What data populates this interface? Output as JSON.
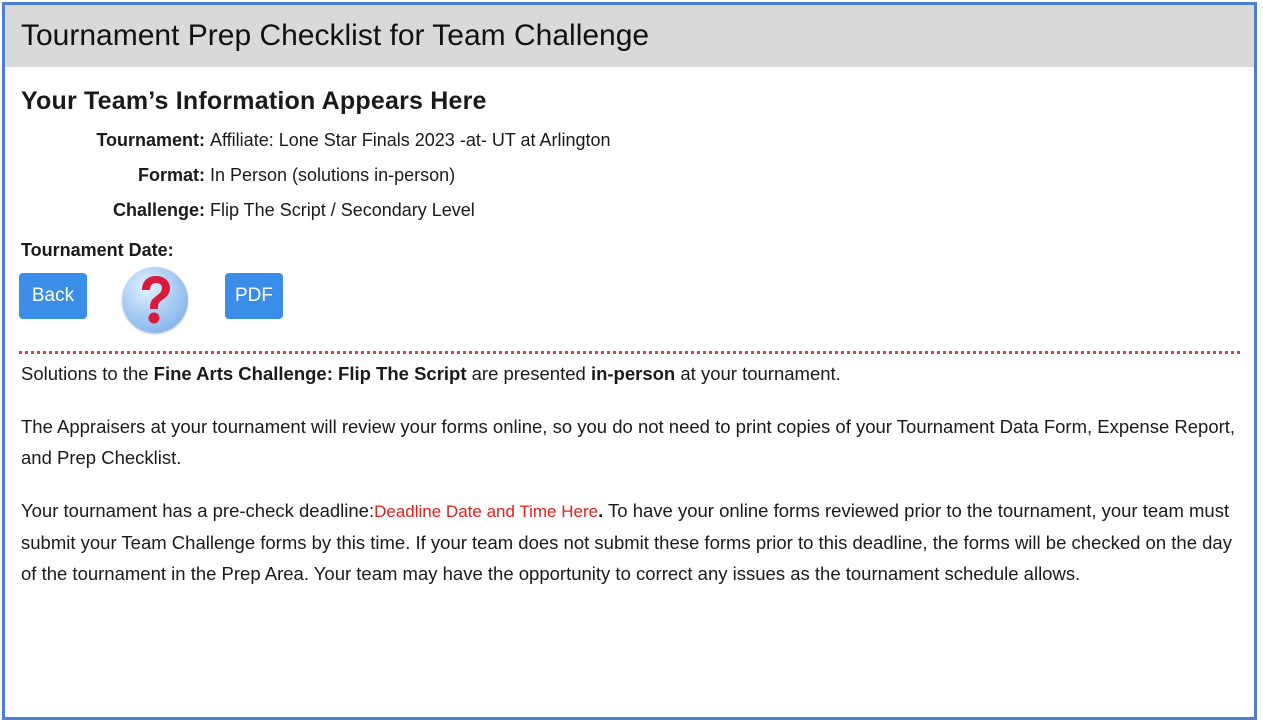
{
  "page_title": "Tournament Prep Checklist for Team Challenge",
  "section_heading": "Your Team’s Information Appears Here",
  "info": [
    {
      "label": "Tournament:",
      "value": "Affiliate: Lone Star Finals 2023 -at- UT at Arlington"
    },
    {
      "label": "Format:",
      "value": "In Person (solutions in-person)"
    },
    {
      "label": "Challenge:",
      "value": "Flip The Script / Secondary Level"
    }
  ],
  "date_label": "Tournament Date:",
  "buttons": {
    "back": "Back",
    "help_icon": "question-mark-icon",
    "pdf": "PDF"
  },
  "colors": {
    "title_bar": "#d9d9d9",
    "button": "#3b8ee8",
    "frame_border": "#4a7fd4",
    "divider": "#d9444b",
    "deadline": "#e51d1d"
  },
  "paragraph1": {
    "pre": "Solutions to the ",
    "bold1": "Fine Arts Challenge: Flip The Script",
    "mid": " are presented ",
    "bold2": "in-person",
    "post": " at your tournament."
  },
  "paragraph2": "The Appraisers at your tournament will review your forms online, so you do not need to print copies of your Tournament Data Form, Expense Report, and Prep Checklist.",
  "paragraph3": {
    "pre": "Your tournament has a pre-check deadline:",
    "deadline": "Deadline Date and Time Here",
    "period": ".",
    "post": " To have your online forms reviewed prior to the tournament, your team must submit your Team Challenge forms by this time. If your team does not submit these forms prior to this deadline, the forms will be checked on the day of the tournament in the Prep Area. Your team may have the opportunity to correct any issues as the tournament schedule allows."
  }
}
